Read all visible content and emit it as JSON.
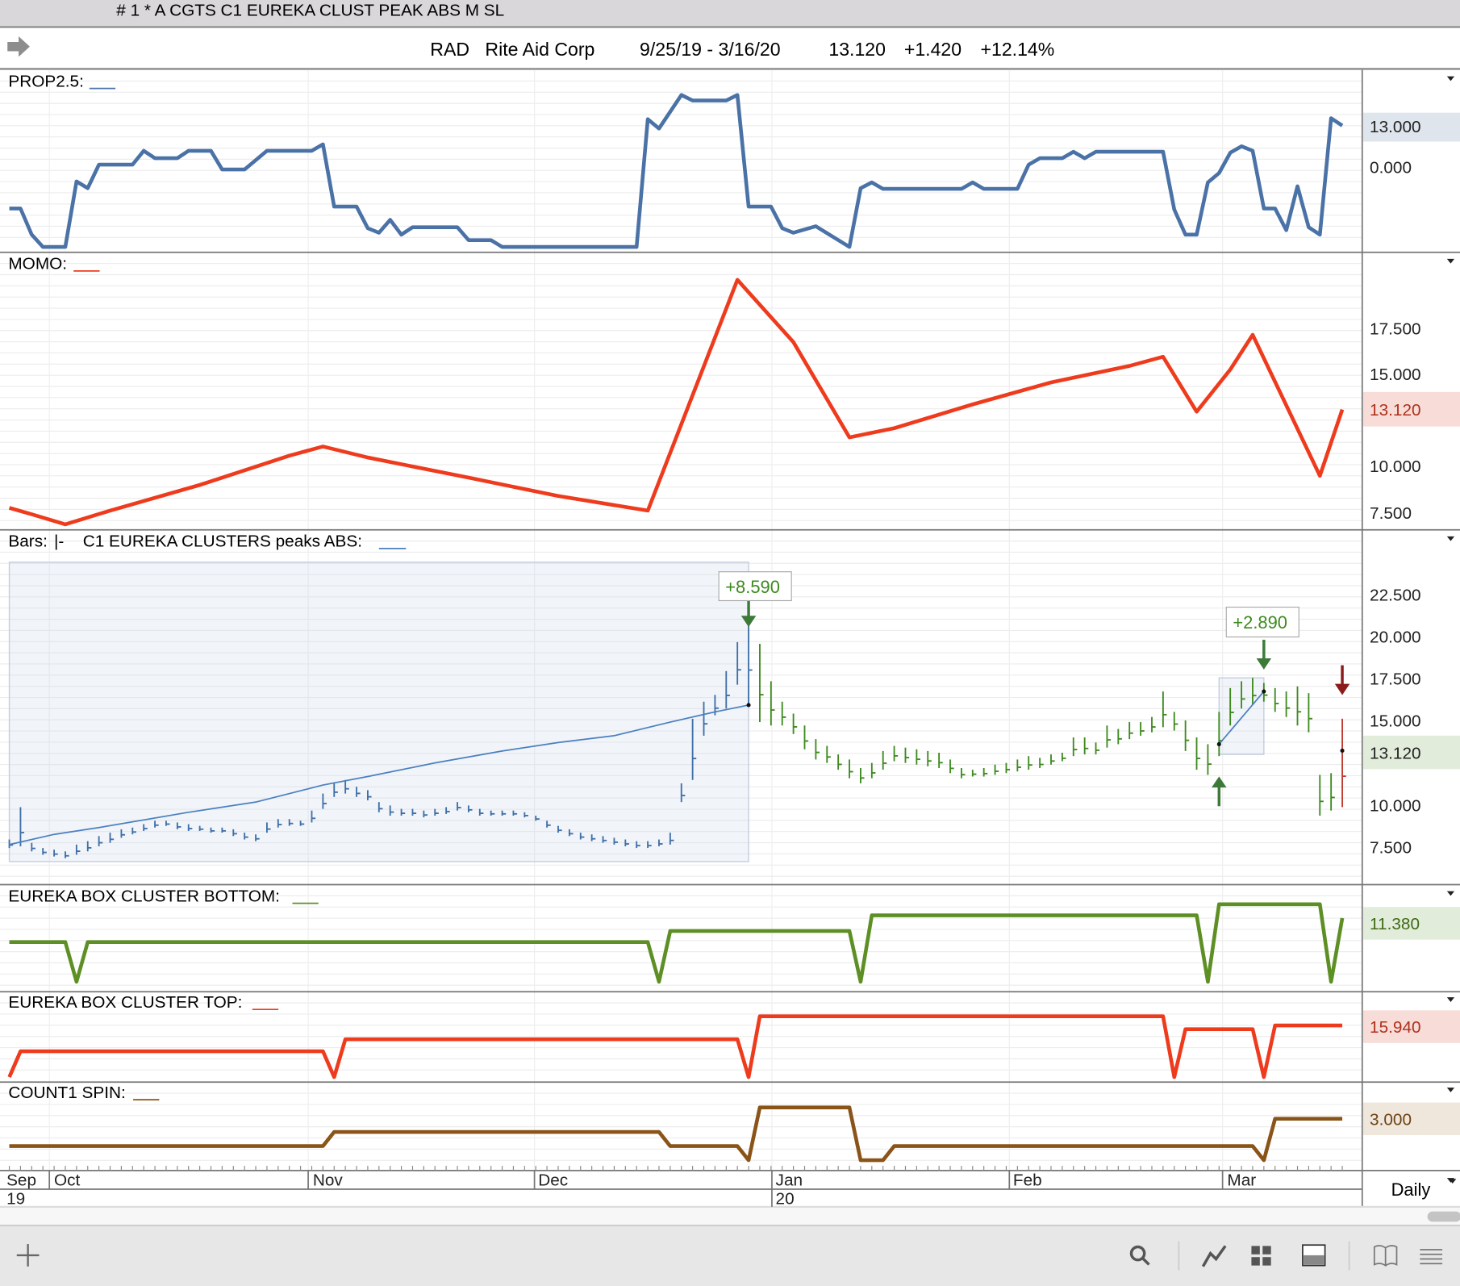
{
  "window": {
    "title": "# 1 * A CGTS  C1 EUREKA CLUST PEAK ABS M  SL"
  },
  "header": {
    "symbol": "RAD",
    "company": "Rite Aid Corp",
    "date_range": "9/25/19 - 3/16/20",
    "last": "13.120",
    "change": "+1.420",
    "change_pct": "+12.14%"
  },
  "panels": {
    "prop": {
      "label": "PROP2.5:",
      "ticks": [
        "0.000"
      ],
      "value_badge": "13.000",
      "color": "#4a72a6"
    },
    "momo": {
      "label": "MOMO:",
      "ticks": [
        "17.500",
        "15.000",
        "10.000",
        "7.500"
      ],
      "value_badge": "13.120",
      "color": "#ee3b1d"
    },
    "bars": {
      "label": "Bars:",
      "bars_glyph": "|-",
      "study_label": "C1 EUREKA CLUSTERS peaks ABS:",
      "ticks": [
        "22.500",
        "20.000",
        "17.500",
        "15.000",
        "10.000",
        "7.500"
      ],
      "value_badge": "13.120",
      "annotation_1": "+8.590",
      "annotation_2": "+2.890"
    },
    "bottom": {
      "label": "EUREKA BOX CLUSTER BOTTOM:",
      "value_badge": "11.380",
      "color": "#5e8f25"
    },
    "top": {
      "label": "EUREKA BOX CLUSTER TOP:",
      "value_badge": "15.940",
      "color": "#ee3b1d"
    },
    "count": {
      "label": "COUNT1 SPIN:",
      "value_badge": "3.000",
      "color": "#8a5418"
    }
  },
  "date_axis": {
    "months": [
      "Sep",
      "Oct",
      "Nov",
      "Dec",
      "Jan",
      "Feb",
      "Mar"
    ],
    "years": [
      "19",
      "20"
    ],
    "period": "Daily"
  },
  "chart_data": [
    {
      "type": "line",
      "title": "PROP2.5",
      "x_unit": "trading day index",
      "points": [
        [
          0,
          -12.7
        ],
        [
          1,
          -12.7
        ],
        [
          2,
          -20.8
        ],
        [
          3,
          -24.6
        ],
        [
          5,
          -24.6
        ],
        [
          6,
          -4.3
        ],
        [
          7,
          -6.4
        ],
        [
          8,
          0.9
        ],
        [
          11,
          0.9
        ],
        [
          12,
          5.2
        ],
        [
          13,
          2.9
        ],
        [
          15,
          2.9
        ],
        [
          16,
          5.2
        ],
        [
          18,
          5.2
        ],
        [
          19,
          -0.6
        ],
        [
          21,
          -0.6
        ],
        [
          23,
          5.2
        ],
        [
          27,
          5.2
        ],
        [
          28,
          7.2
        ],
        [
          29,
          -12.1
        ],
        [
          31,
          -12.1
        ],
        [
          32,
          -18.8
        ],
        [
          33,
          -20.2
        ],
        [
          34,
          -16.2
        ],
        [
          35,
          -20.8
        ],
        [
          36,
          -18.5
        ],
        [
          40,
          -18.5
        ],
        [
          41,
          -22.5
        ],
        [
          43,
          -22.5
        ],
        [
          44,
          -24.6
        ],
        [
          56,
          -24.6
        ],
        [
          57,
          15
        ],
        [
          58,
          12.1
        ],
        [
          60,
          22.5
        ],
        [
          61,
          20.8
        ],
        [
          64,
          20.8
        ],
        [
          65,
          22.5
        ],
        [
          66,
          -12.1
        ],
        [
          68,
          -12.1
        ],
        [
          69,
          -18.8
        ],
        [
          70,
          -20.2
        ],
        [
          72,
          -18.2
        ],
        [
          75,
          -24.6
        ],
        [
          76,
          -6.4
        ],
        [
          77,
          -4.6
        ],
        [
          78,
          -6.6
        ],
        [
          85,
          -6.6
        ],
        [
          86,
          -4.6
        ],
        [
          87,
          -6.6
        ],
        [
          90,
          -6.6
        ],
        [
          91,
          0.9
        ],
        [
          92,
          2.9
        ],
        [
          94,
          2.9
        ],
        [
          95,
          4.9
        ],
        [
          96,
          2.9
        ],
        [
          97,
          4.9
        ],
        [
          103,
          4.9
        ],
        [
          104,
          -13
        ],
        [
          105,
          -20.8
        ],
        [
          106,
          -20.8
        ],
        [
          107,
          -4.6
        ],
        [
          108,
          -1.7
        ],
        [
          109,
          4.6
        ],
        [
          110,
          6.6
        ],
        [
          111,
          5.2
        ],
        [
          112,
          -12.7
        ],
        [
          113,
          -12.7
        ],
        [
          114,
          -19.4
        ],
        [
          115,
          -5.8
        ],
        [
          116,
          -18.5
        ],
        [
          117,
          -20.8
        ],
        [
          118,
          15.3
        ],
        [
          119,
          13.0
        ]
      ],
      "ylim": [
        -26,
        30.3
      ]
    },
    {
      "type": "line",
      "title": "MOMO",
      "points": [
        [
          0,
          7.75
        ],
        [
          2,
          7.4
        ],
        [
          5,
          6.85
        ],
        [
          9,
          7.6
        ],
        [
          17,
          9.0
        ],
        [
          25,
          10.6
        ],
        [
          28,
          11.1
        ],
        [
          32,
          10.5
        ],
        [
          41,
          9.4
        ],
        [
          49,
          8.4
        ],
        [
          57,
          7.6
        ],
        [
          65,
          20.2
        ],
        [
          70,
          16.8
        ],
        [
          75,
          11.6
        ],
        [
          79,
          12.1
        ],
        [
          86,
          13.4
        ],
        [
          93,
          14.6
        ],
        [
          100,
          15.5
        ],
        [
          103,
          16.0
        ],
        [
          106,
          13.0
        ],
        [
          109,
          15.3
        ],
        [
          111,
          17.2
        ],
        [
          117,
          9.5
        ],
        [
          119,
          13.12
        ]
      ],
      "ylim": [
        6.6,
        21.7
      ]
    },
    {
      "type": "ohlc",
      "title": "RAD Daily Bars",
      "fields": [
        "high",
        "low"
      ],
      "bars": [
        [
          7.9,
          7.4
        ],
        [
          9.8,
          7.5
        ],
        [
          7.7,
          7.2
        ],
        [
          7.4,
          7.0
        ],
        [
          7.3,
          6.9
        ],
        [
          7.2,
          6.8
        ],
        [
          7.6,
          7.0
        ],
        [
          7.8,
          7.2
        ],
        [
          8.1,
          7.5
        ],
        [
          8.3,
          7.7
        ],
        [
          8.5,
          8.0
        ],
        [
          8.6,
          8.2
        ],
        [
          8.8,
          8.4
        ],
        [
          9.0,
          8.6
        ],
        [
          9.0,
          8.7
        ],
        [
          8.9,
          8.5
        ],
        [
          8.8,
          8.4
        ],
        [
          8.7,
          8.4
        ],
        [
          8.6,
          8.3
        ],
        [
          8.6,
          8.3
        ],
        [
          8.5,
          8.1
        ],
        [
          8.3,
          7.9
        ],
        [
          8.2,
          7.8
        ],
        [
          8.9,
          8.3
        ],
        [
          9.1,
          8.6
        ],
        [
          9.1,
          8.7
        ],
        [
          9.0,
          8.7
        ],
        [
          9.6,
          8.9
        ],
        [
          10.6,
          9.7
        ],
        [
          11.2,
          10.4
        ],
        [
          11.4,
          10.6
        ],
        [
          11.0,
          10.4
        ],
        [
          10.8,
          10.2
        ],
        [
          10.1,
          9.5
        ],
        [
          9.9,
          9.3
        ],
        [
          9.7,
          9.3
        ],
        [
          9.7,
          9.3
        ],
        [
          9.6,
          9.2
        ],
        [
          9.7,
          9.3
        ],
        [
          9.8,
          9.4
        ],
        [
          10.1,
          9.6
        ],
        [
          9.9,
          9.5
        ],
        [
          9.7,
          9.3
        ],
        [
          9.6,
          9.3
        ],
        [
          9.6,
          9.3
        ],
        [
          9.6,
          9.3
        ],
        [
          9.5,
          9.2
        ],
        [
          9.3,
          9.0
        ],
        [
          9.0,
          8.6
        ],
        [
          8.7,
          8.3
        ],
        [
          8.5,
          8.1
        ],
        [
          8.3,
          7.9
        ],
        [
          8.2,
          7.8
        ],
        [
          8.1,
          7.7
        ],
        [
          8.0,
          7.6
        ],
        [
          7.9,
          7.5
        ],
        [
          7.8,
          7.4
        ],
        [
          7.8,
          7.4
        ],
        [
          7.9,
          7.5
        ],
        [
          8.3,
          7.6
        ],
        [
          11.2,
          10.1
        ],
        [
          15.0,
          11.4
        ],
        [
          16.0,
          14.0
        ],
        [
          16.4,
          15.2
        ],
        [
          17.8,
          15.6
        ],
        [
          19.5,
          17.0
        ],
        [
          21.5,
          15.9
        ],
        [
          19.4,
          14.8
        ],
        [
          17.2,
          14.6
        ],
        [
          16.0,
          14.6
        ],
        [
          15.3,
          14.1
        ],
        [
          14.6,
          13.2
        ],
        [
          13.8,
          12.6
        ],
        [
          13.4,
          12.4
        ],
        [
          12.9,
          12.0
        ],
        [
          12.6,
          11.5
        ],
        [
          12.1,
          11.2
        ],
        [
          12.4,
          11.5
        ],
        [
          13.1,
          12.0
        ],
        [
          13.4,
          12.5
        ],
        [
          13.3,
          12.4
        ],
        [
          13.2,
          12.3
        ],
        [
          13.1,
          12.2
        ],
        [
          13.0,
          12.1
        ],
        [
          12.6,
          11.8
        ],
        [
          12.1,
          11.5
        ],
        [
          12.0,
          11.6
        ],
        [
          12.1,
          11.6
        ],
        [
          12.3,
          11.7
        ],
        [
          12.4,
          11.8
        ],
        [
          12.6,
          11.9
        ],
        [
          12.8,
          12.0
        ],
        [
          12.7,
          12.1
        ],
        [
          12.9,
          12.3
        ],
        [
          13.0,
          12.5
        ],
        [
          13.9,
          12.8
        ],
        [
          13.9,
          12.9
        ],
        [
          13.6,
          12.9
        ],
        [
          14.6,
          13.3
        ],
        [
          14.4,
          13.5
        ],
        [
          14.8,
          13.8
        ],
        [
          14.8,
          14.0
        ],
        [
          15.1,
          14.2
        ],
        [
          16.6,
          14.5
        ],
        [
          15.4,
          14.3
        ],
        [
          14.9,
          13.1
        ],
        [
          13.9,
          12.0
        ],
        [
          13.5,
          11.7
        ],
        [
          15.4,
          12.8
        ],
        [
          16.8,
          14.6
        ],
        [
          17.2,
          15.6
        ],
        [
          17.4,
          15.8
        ],
        [
          17.1,
          16.0
        ],
        [
          16.8,
          15.4
        ],
        [
          16.6,
          15.1
        ],
        [
          16.9,
          14.6
        ],
        [
          16.5,
          14.2
        ],
        [
          11.7,
          9.3
        ],
        [
          11.8,
          9.6
        ],
        [
          15.0,
          9.8
        ]
      ],
      "cluster_line_1": [
        [
          0,
          7.6
        ],
        [
          4,
          8.2
        ],
        [
          8,
          8.6
        ],
        [
          16,
          9.5
        ],
        [
          22,
          10.1
        ],
        [
          28,
          11.1
        ],
        [
          32,
          11.6
        ],
        [
          38,
          12.4
        ],
        [
          44,
          13.1
        ],
        [
          49,
          13.6
        ],
        [
          54,
          14.0
        ],
        [
          59,
          14.8
        ],
        [
          63,
          15.4
        ],
        [
          66,
          15.8
        ]
      ],
      "cluster_line_2": [
        [
          108,
          13.5
        ],
        [
          112,
          16.6
        ]
      ],
      "cluster_boxes": [
        {
          "from": 0,
          "to": 66,
          "high": 24.2,
          "low": 6.6
        },
        {
          "from": 108,
          "to": 112,
          "high": 17.4,
          "low": 12.9
        }
      ],
      "signals": [
        {
          "i": 66,
          "type": "sell",
          "at": 20.5
        },
        {
          "i": 112,
          "type": "sell",
          "at": 18.0
        },
        {
          "i": 108,
          "type": "buy",
          "at": 11.5
        },
        {
          "i": 119,
          "type": "exit",
          "at": 16.5
        }
      ],
      "ylim": [
        5.3,
        26.1
      ]
    },
    {
      "type": "line",
      "title": "EUREKA BOX CLUSTER BOTTOM",
      "points": [
        [
          0,
          8.78
        ],
        [
          5,
          8.78
        ],
        [
          6,
          4.48
        ],
        [
          7,
          8.78
        ],
        [
          57,
          8.78
        ],
        [
          58,
          4.48
        ],
        [
          59,
          9.98
        ],
        [
          75,
          9.98
        ],
        [
          76,
          4.48
        ],
        [
          77,
          11.68
        ],
        [
          106,
          11.68
        ],
        [
          107,
          4.48
        ],
        [
          108,
          12.88
        ],
        [
          117,
          12.88
        ],
        [
          118,
          4.48
        ],
        [
          119,
          11.38
        ]
      ],
      "ylim": [
        3.5,
        15
      ]
    },
    {
      "type": "line",
      "title": "EUREKA BOX CLUSTER TOP",
      "points": [
        [
          0,
          10.34
        ],
        [
          1,
          13.14
        ],
        [
          28,
          13.14
        ],
        [
          29,
          10.34
        ],
        [
          30,
          14.44
        ],
        [
          65,
          14.44
        ],
        [
          66,
          10.34
        ],
        [
          67,
          16.94
        ],
        [
          103,
          16.94
        ],
        [
          104,
          10.34
        ],
        [
          105,
          15.54
        ],
        [
          111,
          15.54
        ],
        [
          112,
          10.34
        ],
        [
          113,
          15.94
        ],
        [
          119,
          15.94
        ]
      ],
      "ylim": [
        9.9,
        19.6
      ]
    },
    {
      "type": "line",
      "title": "COUNT1 SPIN",
      "points": [
        [
          0,
          0.1
        ],
        [
          28,
          0.1
        ],
        [
          29,
          1.6
        ],
        [
          58,
          1.6
        ],
        [
          59,
          0.1
        ],
        [
          65,
          0.1
        ],
        [
          66,
          -1.4
        ],
        [
          67,
          4.2
        ],
        [
          75,
          4.2
        ],
        [
          76,
          -1.4
        ],
        [
          78,
          -1.4
        ],
        [
          79,
          0.1
        ],
        [
          111,
          0.1
        ],
        [
          112,
          -1.4
        ],
        [
          113,
          3.0
        ],
        [
          119,
          3.0
        ]
      ],
      "ylim": [
        -2.4,
        6.9
      ]
    }
  ],
  "toolbar": {
    "icons": [
      "plus-icon",
      "search-icon",
      "line-chart-icon",
      "grid-icon",
      "panel-icon",
      "book-icon",
      "menu-icon"
    ]
  }
}
